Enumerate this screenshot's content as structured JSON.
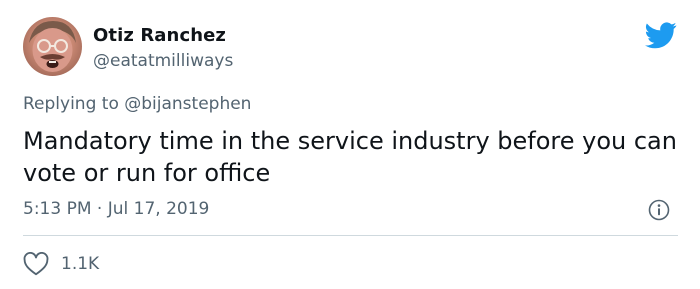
{
  "author": {
    "name": "Otiz Ranchez",
    "handle": "@eatatmilliways"
  },
  "reply": {
    "prefix": "Replying to",
    "mention": "@bijanstephen"
  },
  "tweet": {
    "text": "Mandatory time in the service industry before you can vote or run for office",
    "timestamp": "5:13 PM · Jul 17, 2019"
  },
  "engagement": {
    "likes": "1.1K"
  },
  "icons": {
    "brand": "twitter-bird-icon",
    "info": "info-icon",
    "like": "heart-icon"
  },
  "colors": {
    "brand": "#1d9bf0",
    "text": "#0f1419",
    "secondary": "#536471",
    "divider": "#cfd9de"
  }
}
